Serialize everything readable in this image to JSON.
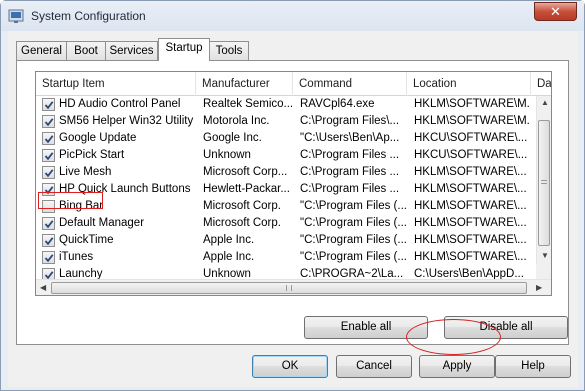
{
  "window": {
    "title": "System Configuration",
    "close_label": "✕"
  },
  "tabs": [
    {
      "label": "General",
      "active": false
    },
    {
      "label": "Boot",
      "active": false
    },
    {
      "label": "Services",
      "active": false
    },
    {
      "label": "Startup",
      "active": true
    },
    {
      "label": "Tools",
      "active": false
    }
  ],
  "table": {
    "columns": [
      "Startup Item",
      "Manufacturer",
      "Command",
      "Location",
      "Da"
    ],
    "rows": [
      {
        "item": "HD Audio Control Panel",
        "manufacturer": "Realtek Semico...",
        "command": "RAVCpl64.exe",
        "location": "HKLM\\SOFTWARE\\M...",
        "checked": true
      },
      {
        "item": "SM56 Helper Win32 Utility",
        "manufacturer": "Motorola Inc.",
        "command": "C:\\Program Files\\...",
        "location": "HKLM\\SOFTWARE\\M...",
        "checked": true
      },
      {
        "item": "Google Update",
        "manufacturer": "Google Inc.",
        "command": "\"C:\\Users\\Ben\\Ap...",
        "location": "HKCU\\SOFTWARE\\...",
        "checked": true
      },
      {
        "item": "PicPick Start",
        "manufacturer": "Unknown",
        "command": "C:\\Program Files ...",
        "location": "HKCU\\SOFTWARE\\...",
        "checked": true
      },
      {
        "item": "Live Mesh",
        "manufacturer": "Microsoft Corp...",
        "command": "C:\\Program Files ...",
        "location": "HKLM\\SOFTWARE\\...",
        "checked": true
      },
      {
        "item": "HP Quick Launch Buttons",
        "manufacturer": "Hewlett-Packar...",
        "command": "C:\\Program Files ...",
        "location": "HKLM\\SOFTWARE\\...",
        "checked": true
      },
      {
        "item": "Bing Bar",
        "manufacturer": "Microsoft Corp.",
        "command": "\"C:\\Program Files (...",
        "location": "HKLM\\SOFTWARE\\...",
        "checked": false
      },
      {
        "item": "Default Manager",
        "manufacturer": "Microsoft Corp.",
        "command": "\"C:\\Program Files (...",
        "location": "HKLM\\SOFTWARE\\...",
        "checked": true
      },
      {
        "item": "QuickTime",
        "manufacturer": "Apple Inc.",
        "command": "\"C:\\Program Files (...",
        "location": "HKLM\\SOFTWARE\\...",
        "checked": true
      },
      {
        "item": "iTunes",
        "manufacturer": "Apple Inc.",
        "command": "\"C:\\Program Files (...",
        "location": "HKLM\\SOFTWARE\\...",
        "checked": true
      },
      {
        "item": "Launchy",
        "manufacturer": "Unknown",
        "command": "C:\\PROGRA~2\\La...",
        "location": "C:\\Users\\Ben\\AppD...",
        "checked": true
      }
    ]
  },
  "actions": {
    "enable_all": "Enable all",
    "disable_all": "Disable all"
  },
  "footer": {
    "ok": "OK",
    "cancel": "Cancel",
    "apply": "Apply",
    "help": "Help"
  },
  "colors": {
    "highlight": "#e02020",
    "window_frame": "#8a9bb4"
  }
}
